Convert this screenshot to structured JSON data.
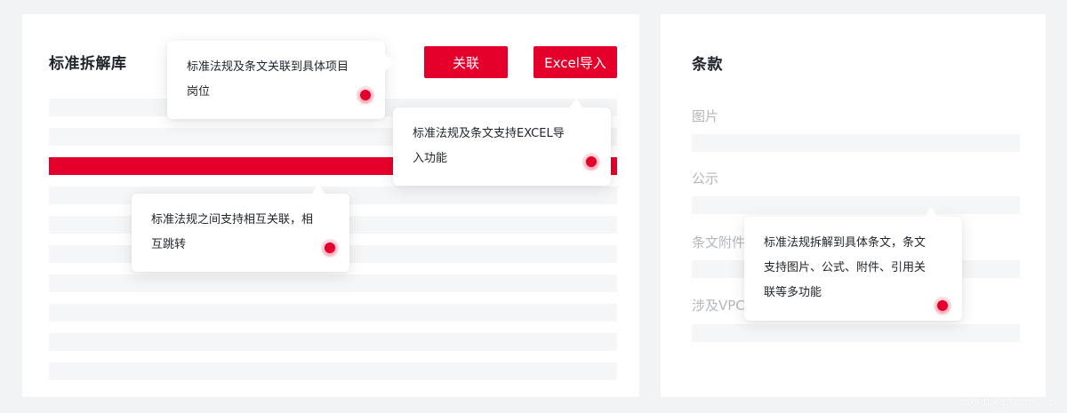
{
  "left_panel": {
    "title": "标准拆解库",
    "link_button": "关联",
    "import_button": "Excel导入"
  },
  "right_panel": {
    "title": "条款",
    "fields": [
      {
        "label": "图片"
      },
      {
        "label": "公示"
      },
      {
        "label": "条文附件"
      },
      {
        "label": "涉及VPC"
      }
    ]
  },
  "tooltips": {
    "link_to_positions": [
      "标准法规及条文关联到具体项目",
      "岗位"
    ],
    "excel_import": [
      "标准法规及条文支持EXCEL导",
      "入功能"
    ],
    "cross_jump": [
      "标准法规之间支持相互关联，相",
      "互跳转"
    ],
    "decompose": [
      "标准法规拆解到具体条文，条文",
      "支持图片、公式、附件、引用关",
      "联等多功能"
    ]
  },
  "watermark": "goodbeifeng.com",
  "colors": {
    "accent": "#e5002b",
    "background": "#f2f3f5",
    "row": "#f5f6f7"
  }
}
